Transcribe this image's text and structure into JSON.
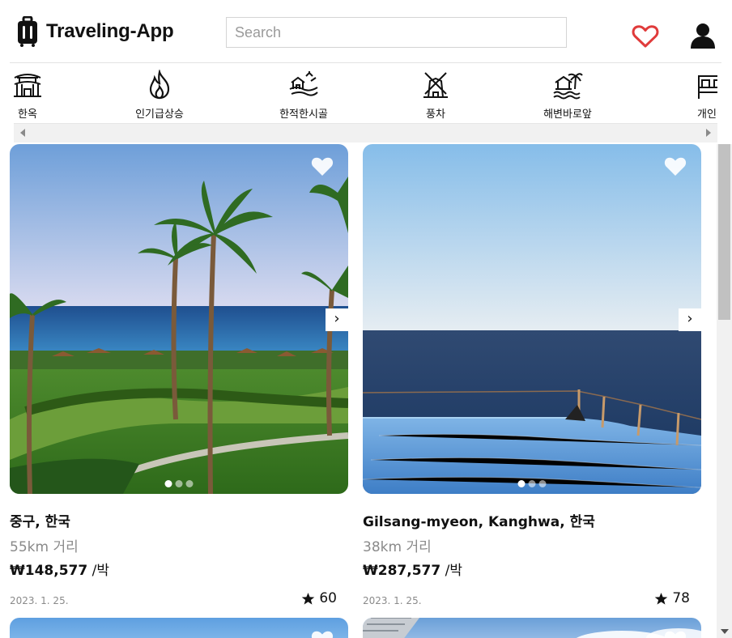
{
  "header": {
    "app_name": "Traveling-App",
    "logo_icon": "suitcase-icon",
    "search_placeholder": "Search",
    "search_value": "",
    "wishlist_icon": "heart-outline-icon",
    "profile_icon": "user-icon",
    "accent_color": "#e03b3b"
  },
  "categories": [
    {
      "label": "한옥",
      "icon": "hanok-icon"
    },
    {
      "label": "인기급상승",
      "icon": "fire-icon"
    },
    {
      "label": "한적한시골",
      "icon": "countryside-icon"
    },
    {
      "label": "풍차",
      "icon": "windmill-icon"
    },
    {
      "label": "해변바로앞",
      "icon": "beachfront-icon"
    },
    {
      "label": "개인실",
      "icon": "private-room-icon"
    }
  ],
  "listings": [
    {
      "location": "중구, 한국",
      "distance": "55km 거리",
      "price": "₩148,577",
      "price_unit": "/박",
      "date": "2023. 1. 25.",
      "rating": "60",
      "photo_count": 3,
      "active_photo": 0
    },
    {
      "location": "Gilsang-myeon, Kanghwa, 한국",
      "distance": "38km 거리",
      "price": "₩287,577",
      "price_unit": "/박",
      "date": "2023. 1. 25.",
      "rating": "78",
      "photo_count": 3,
      "active_photo": 0
    }
  ],
  "carousel_next_glyph": "›"
}
